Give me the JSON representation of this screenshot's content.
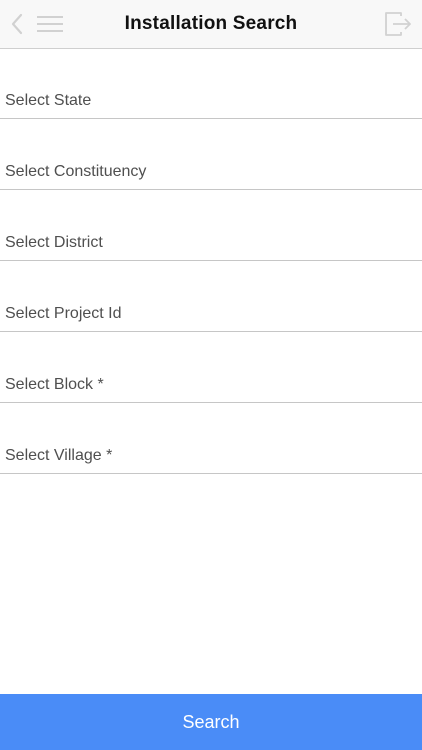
{
  "navbar": {
    "title": "Installation Search",
    "left_icons": [
      "back-icon",
      "menu-icon"
    ],
    "right_icon": "logout-icon"
  },
  "form": {
    "fields": [
      {
        "label": "Select State"
      },
      {
        "label": "Select Constituency"
      },
      {
        "label": "Select District"
      },
      {
        "label": "Select Project Id"
      },
      {
        "label": "Select Block *"
      },
      {
        "label": "Select Village *"
      }
    ]
  },
  "footer": {
    "search_label": "Search"
  },
  "colors": {
    "accent": "#4a8cf7",
    "navbar_bg": "#f8f8f8",
    "divider": "#c6c6c6",
    "label_text": "#4f4f4f"
  }
}
